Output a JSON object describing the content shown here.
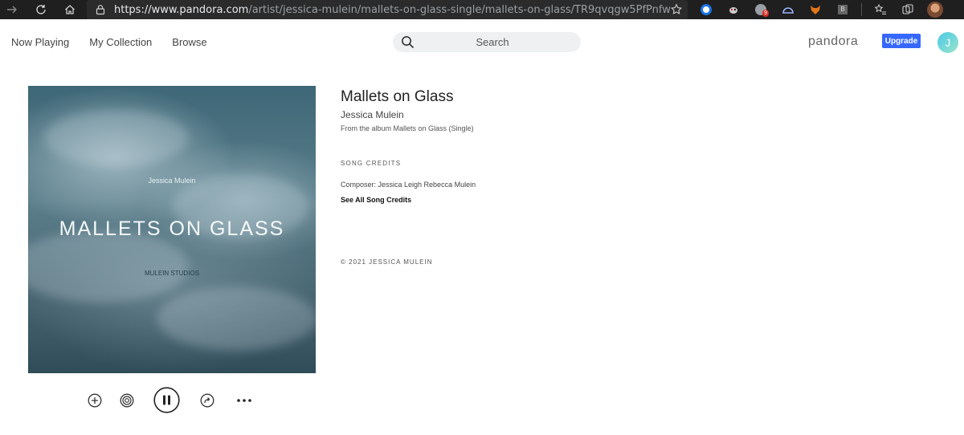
{
  "browser": {
    "url_host": "https://www.pandora.com",
    "url_path": "/artist/jessica-mulein/mallets-on-glass-single/mallets-on-glass/TR9qvqgw5PfPnfw",
    "extension_badge": "9",
    "extension_b_label": "B"
  },
  "nav": {
    "links": [
      "Now Playing",
      "My Collection",
      "Browse"
    ],
    "search_placeholder": "Search",
    "brand": "pandora",
    "upgrade_label": "Upgrade",
    "avatar_initial": "J"
  },
  "album_art": {
    "artist": "Jessica Mulein",
    "title": "MALLETS ON GLASS",
    "label": "MULEIN STUDIOS"
  },
  "song": {
    "title": "Mallets on Glass",
    "artist": "Jessica Mulein",
    "from_album": "From the album Mallets on Glass (Single)",
    "credits_heading": "SONG CREDITS",
    "composer": "Composer: Jessica Leigh Rebecca Mulein",
    "see_all": "See All Song Credits",
    "copyright": "© 2021 JESSICA MULEIN"
  },
  "player": {
    "state": "playing",
    "controls": [
      "add-icon",
      "station-icon",
      "pause-icon",
      "share-icon",
      "more-icon"
    ]
  },
  "colors": {
    "upgrade": "#3668ff",
    "chrome_bg": "#1f1f1f"
  }
}
